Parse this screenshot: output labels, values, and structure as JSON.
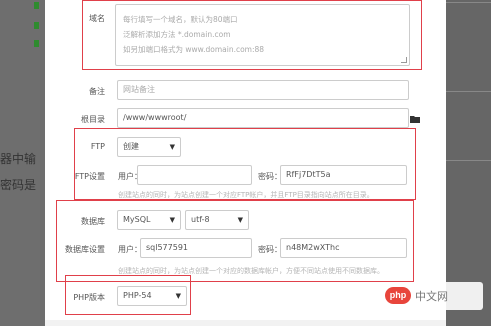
{
  "background": {
    "left_chars": [
      "器中输",
      "密码是"
    ],
    "accent": "#2e8b2e"
  },
  "form": {
    "domain": {
      "label": "域名",
      "placeholder_lines": [
        "每行填写一个域名，默认为80端口",
        "泛解析添加方法 *.domain.com",
        "如另加端口格式为 www.domain.com:88"
      ]
    },
    "remark": {
      "label": "备注",
      "placeholder": "网站备注"
    },
    "root": {
      "label": "根目录",
      "value": "/www/wwwroot/",
      "icon": "folder-icon"
    },
    "ftp": {
      "label": "FTP",
      "value": "创建"
    },
    "ftp_settings": {
      "label": "FTP设置",
      "user_label": "用户：",
      "user_value": "",
      "pass_label": "密码：",
      "pass_value": "RfFj7DtT5a",
      "hint": "创建站点的同时，为站点创建一个对应FTP帐户，并且FTP目录指向站点所在目录。"
    },
    "database": {
      "label": "数据库",
      "type": "MySQL",
      "charset": "utf-8"
    },
    "db_settings": {
      "label": "数据库设置",
      "user_label": "用户：",
      "user_value": "sql577591",
      "pass_label": "密码：",
      "pass_value": "n48M2wXThc",
      "hint": "创建站点的同时，为站点创建一个对应的数据库帐户，方便不同站点使用不同数据库。"
    },
    "php": {
      "label": "PHP版本",
      "value": "PHP-54"
    }
  },
  "watermark": {
    "logo": "php",
    "text": "中文网"
  },
  "colors": {
    "highlight": "#e0404a",
    "border": "#cccccc"
  }
}
